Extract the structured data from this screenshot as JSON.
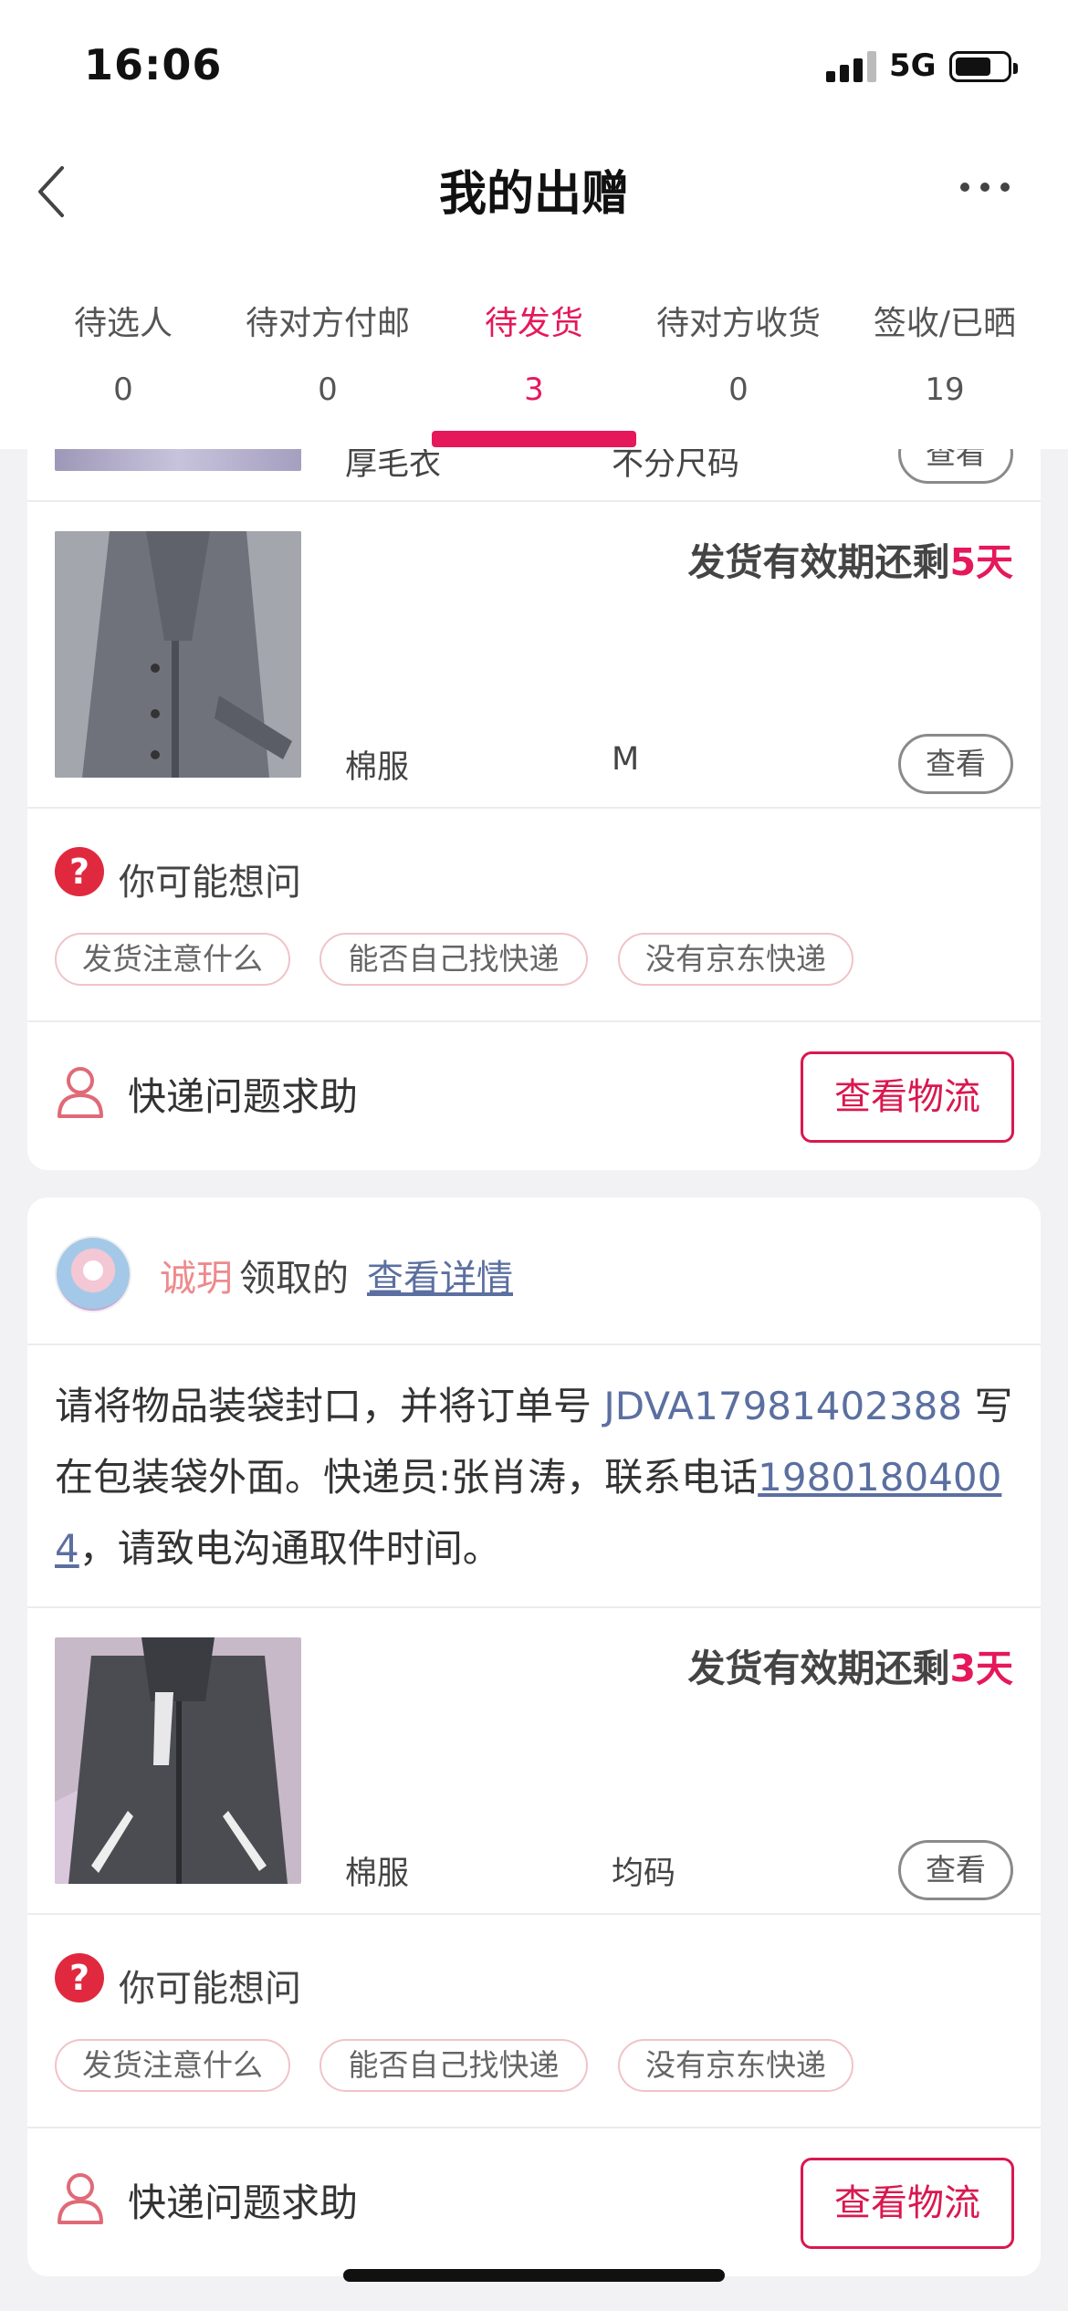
{
  "status": {
    "time": "16:06",
    "network": "5G"
  },
  "nav": {
    "title": "我的出赠"
  },
  "tabs": [
    {
      "label": "待选人",
      "count": "0"
    },
    {
      "label": "待对方付邮",
      "count": "0"
    },
    {
      "label": "待发货",
      "count": "3",
      "active": true
    },
    {
      "label": "待对方收货",
      "count": "0"
    },
    {
      "label": "签收/已晒",
      "count": "19"
    }
  ],
  "partial_item": {
    "name": "厚毛衣",
    "size": "不分尺码",
    "view": "查看"
  },
  "card1": {
    "item": {
      "deadline_prefix": "发货有效期还剩",
      "deadline_days": "5天",
      "name": "棉服",
      "size": "M",
      "view": "查看"
    },
    "faq": {
      "title": "你可能想问",
      "chips": [
        "发货注意什么",
        "能否自己找快递",
        "没有京东快递"
      ]
    },
    "help": {
      "text": "快递问题求助",
      "button": "查看物流"
    }
  },
  "card2": {
    "receiver": {
      "name": "诚玥",
      "action": "领取的",
      "link": "查看详情"
    },
    "instructions": {
      "part1": "请将物品装袋封口，并将订单号 ",
      "order_no": "JDVA17981402388",
      "part2": " 写在包装袋外面。快递员:张肖涛，联系电话",
      "phone": "19801804004",
      "part3": "，请致电沟通取件时间。"
    },
    "item": {
      "deadline_prefix": "发货有效期还剩",
      "deadline_days": "3天",
      "name": "棉服",
      "size": "均码",
      "view": "查看"
    },
    "faq": {
      "title": "你可能想问",
      "chips": [
        "发货注意什么",
        "能否自己找快递",
        "没有京东快递"
      ]
    },
    "help": {
      "text": "快递问题求助",
      "button": "查看物流"
    }
  },
  "colors": {
    "accent": "#e5185b",
    "link": "#5b6fa0",
    "question_icon": "#e0293f"
  }
}
